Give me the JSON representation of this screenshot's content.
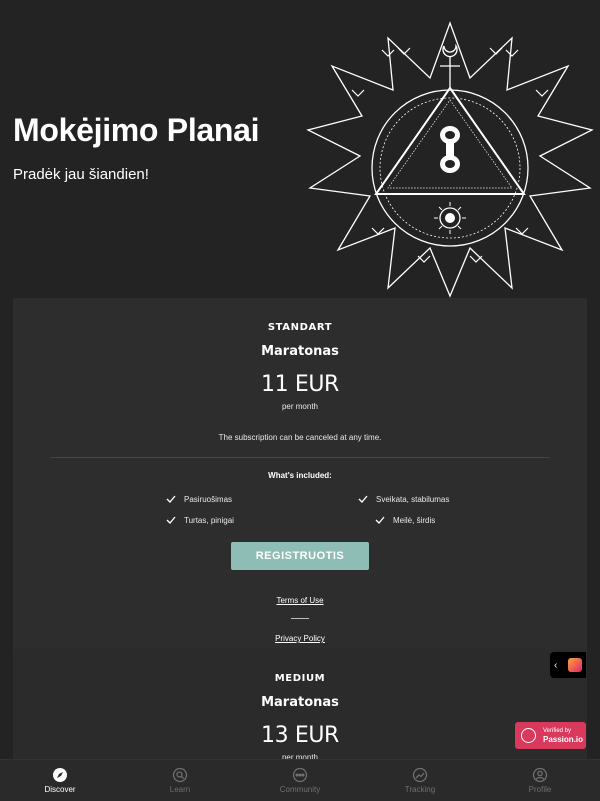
{
  "hero": {
    "title": "Mokėjimo Planai",
    "subtitle": "Pradėk jau šiandien!"
  },
  "plans": [
    {
      "tier": "STANDART",
      "name": "Maratonas",
      "price": "11 EUR",
      "period": "per month",
      "cancel_note": "The subscription can be canceled at any time.",
      "included_heading": "What's included:",
      "features": [
        "Pasiruošimas",
        "Sveikata, stabilumas",
        "Turtas, pinigai",
        "Meilė, širdis"
      ],
      "cta_label": "REGISTRUOTIS",
      "terms_label": "Terms of Use",
      "privacy_label": "Privacy Policy"
    },
    {
      "tier": "MEDIUM",
      "name": "Maratonas",
      "price": "13 EUR",
      "period": "per month"
    }
  ],
  "chat_toggle": {
    "chevron": "‹",
    "app_icon": "app-logo-icon"
  },
  "badge": {
    "line1": "Verified by",
    "line2": "Passion.io"
  },
  "tabbar": {
    "items": [
      {
        "label": "Discover",
        "icon": "compass-icon",
        "active": true
      },
      {
        "label": "Learn",
        "icon": "learn-search-icon",
        "active": false
      },
      {
        "label": "Community",
        "icon": "chat-bubble-icon",
        "active": false
      },
      {
        "label": "Tracking",
        "icon": "trend-icon",
        "active": false
      },
      {
        "label": "Profile",
        "icon": "user-icon",
        "active": false
      }
    ]
  },
  "colors": {
    "background": "#232323",
    "card": "#2d2d2d",
    "cta": "#8ebdb6",
    "badge": "#d9395d",
    "tab_inactive": "#6f6f6f"
  }
}
